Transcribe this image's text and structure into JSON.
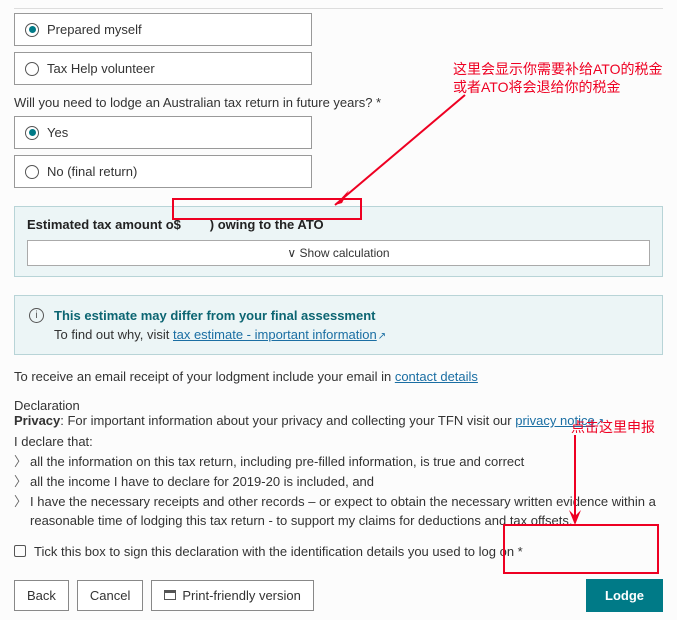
{
  "q1": {
    "opt1": "Prepared myself",
    "opt2": "Tax Help volunteer"
  },
  "q2": {
    "prompt": "Will you need to lodge an Australian tax return in future years? *",
    "opt1": "Yes",
    "opt2": "No (final return)"
  },
  "estimate": {
    "prefix": "Estimated tax amount o",
    "dollar": "$",
    "suffix": " owing to the ATO",
    "show_calc": "Show calculation"
  },
  "info": {
    "title": "This estimate may differ from your final assessment",
    "body_prefix": "To find out why, visit ",
    "link": "tax estimate - important information"
  },
  "receipt": {
    "prefix": "To receive an email receipt of your lodgment include your email in ",
    "link": "contact details"
  },
  "decl": {
    "heading": "Declaration",
    "privacy_label": "Privacy",
    "privacy_text": ": For important information about your privacy and collecting your TFN visit our ",
    "privacy_link": "privacy notice",
    "i_declare": "I declare that:",
    "item1": "all the information on this tax return, including pre-filled information, is true and correct",
    "item2": "all the income I have to declare for 2019-20 is included, and",
    "item3": "I have the necessary receipts and other records – or expect to obtain the necessary written evidence within a reasonable time of lodging this tax return - to support my claims for deductions and tax offsets."
  },
  "tick": {
    "label": "Tick this box to sign this declaration with the identification details you used to log on *"
  },
  "buttons": {
    "back": "Back",
    "cancel": "Cancel",
    "print": "Print-friendly version",
    "lodge": "Lodge"
  },
  "annotations": {
    "a1": "这里会显示你需要补给ATO的税金或者ATO将会退给你的税金",
    "a2": "点击这里申报"
  }
}
